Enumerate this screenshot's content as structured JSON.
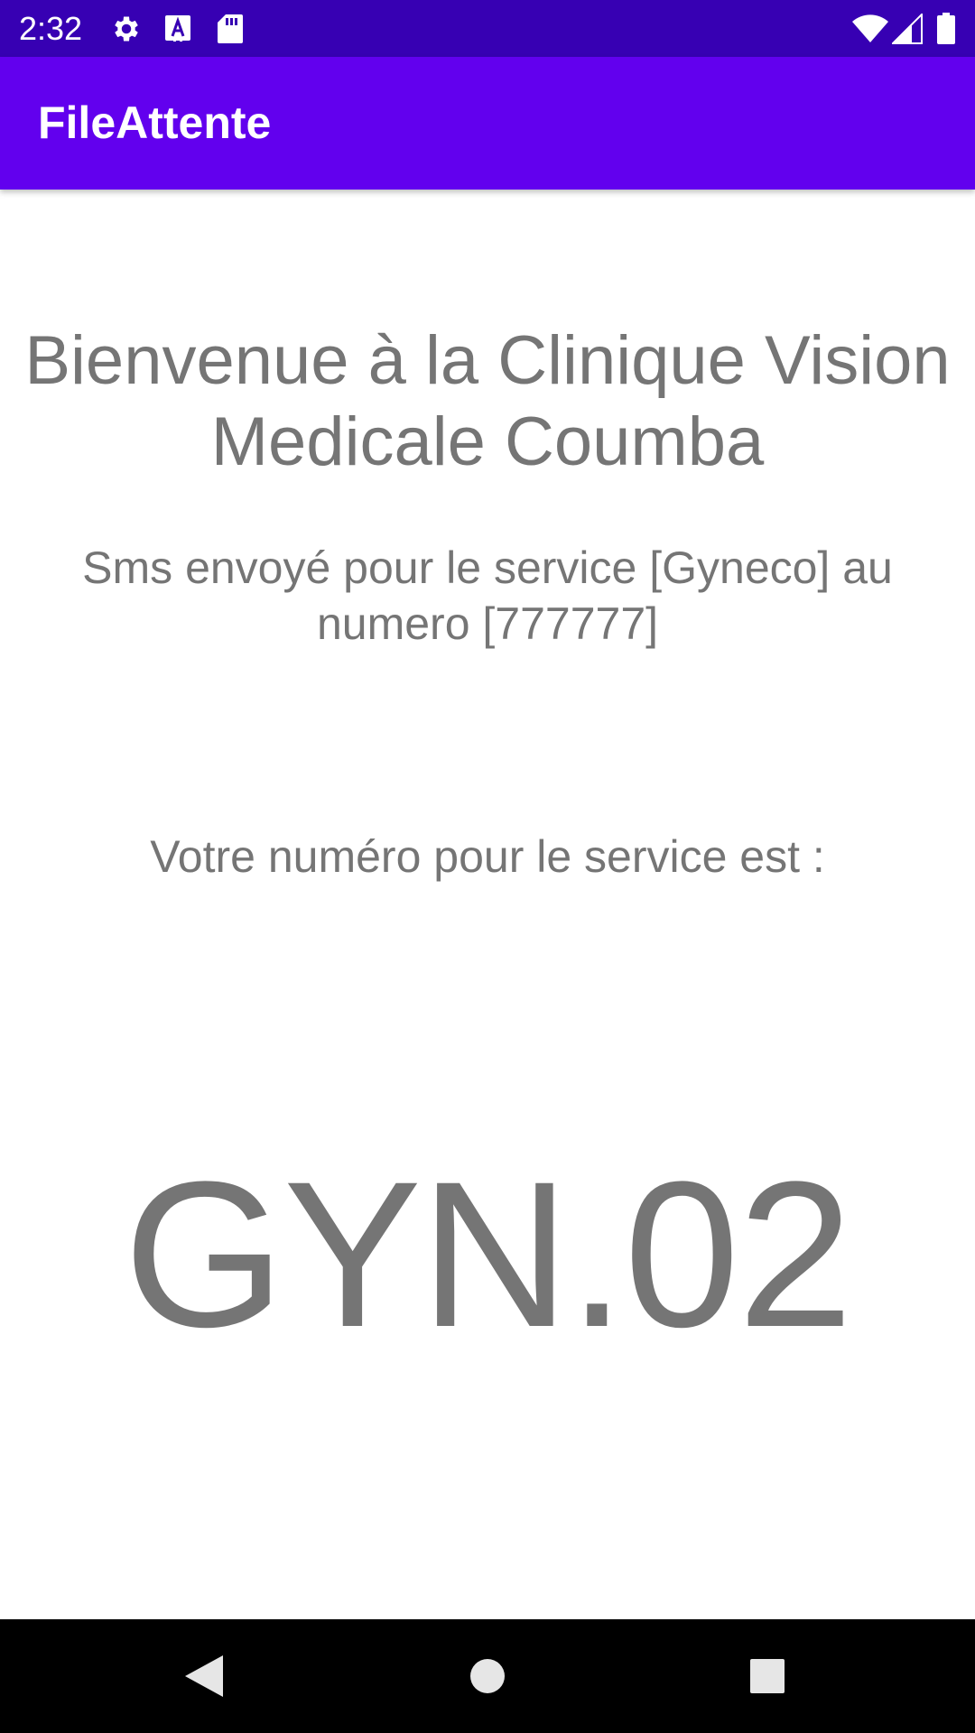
{
  "status_bar": {
    "time": "2:32",
    "icons": [
      "gear-icon",
      "font-icon",
      "sd-card-icon",
      "wifi-icon",
      "signal-icon",
      "battery-icon"
    ]
  },
  "app_bar": {
    "title": "FileAttente"
  },
  "content": {
    "welcome": "Bienvenue à la Clinique Vision Medicale Coumba",
    "sms_message": "Sms envoyé pour le service [Gyneco] au numero [777777]",
    "number_label": "Votre numéro pour le service est :",
    "ticket_number": "GYN.02"
  },
  "nav_bar": {
    "buttons": [
      "back-icon",
      "home-icon",
      "recents-icon"
    ]
  },
  "colors": {
    "status_bar": "#3700b3",
    "app_bar": "#6200ee",
    "text": "#757575"
  }
}
